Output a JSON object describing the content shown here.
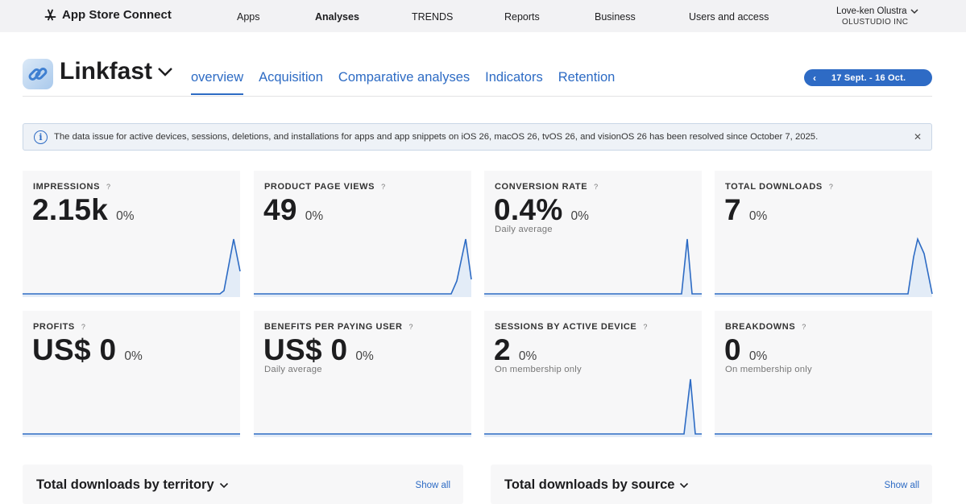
{
  "topnav": {
    "brand": "App Store Connect",
    "items": [
      "Apps",
      "Analyses",
      "TRENDS",
      "Reports",
      "Business",
      "Users and access"
    ],
    "active": "Analyses",
    "user_name": "Love-ken Olustra",
    "org": "OLUSTUDIO INC"
  },
  "app": {
    "name": "Linkfast",
    "tabs": [
      "overview",
      "Acquisition",
      "Comparative analyses",
      "Indicators",
      "Retention"
    ],
    "active_tab": "overview",
    "date_range": "17 Sept. - 16 Oct."
  },
  "banner": {
    "message": "The data issue for active devices, sessions, deletions, and installations for apps and app snippets on iOS 26, macOS 26, tvOS 26, and visionOS 26 has been resolved since October 7, 2025."
  },
  "metrics": [
    {
      "label": "IMPRESSIONS",
      "value": "2.15k",
      "delta": "0%",
      "sub": ""
    },
    {
      "label": "PRODUCT PAGE VIEWS",
      "value": "49",
      "delta": "0%",
      "sub": ""
    },
    {
      "label": "CONVERSION RATE",
      "value": "0.4%",
      "delta": "0%",
      "sub": "Daily average"
    },
    {
      "label": "TOTAL DOWNLOADS",
      "value": "7",
      "delta": "0%",
      "sub": ""
    },
    {
      "label": "PROFITS",
      "value": "US$ 0",
      "delta": "0%",
      "sub": ""
    },
    {
      "label": "BENEFITS PER PAYING USER",
      "value": "US$ 0",
      "delta": "0%",
      "sub": "Daily average"
    },
    {
      "label": "SESSIONS BY ACTIVE DEVICE",
      "value": "2",
      "delta": "0%",
      "sub": "On membership only"
    },
    {
      "label": "BREAKDOWNS",
      "value": "0",
      "delta": "0%",
      "sub": "On membership only"
    }
  ],
  "help_glyph": "?",
  "panels": [
    {
      "title": "Total downloads by territory",
      "show_all": "Show all"
    },
    {
      "title": "Total downloads by source",
      "show_all": "Show all"
    }
  ],
  "colors": {
    "accent": "#2d6bc4",
    "spark_fill": "#e3ecf7",
    "card_bg": "#f7f7f8",
    "nav_bg": "#f2f2f4"
  },
  "icons": {
    "brand": "app-store-icon",
    "app": "chain-link-icon",
    "info": "info-circle-icon",
    "close": "close-icon",
    "dropdown": "chevron-down-icon",
    "prev": "chevron-left-icon",
    "help": "help-icon"
  }
}
